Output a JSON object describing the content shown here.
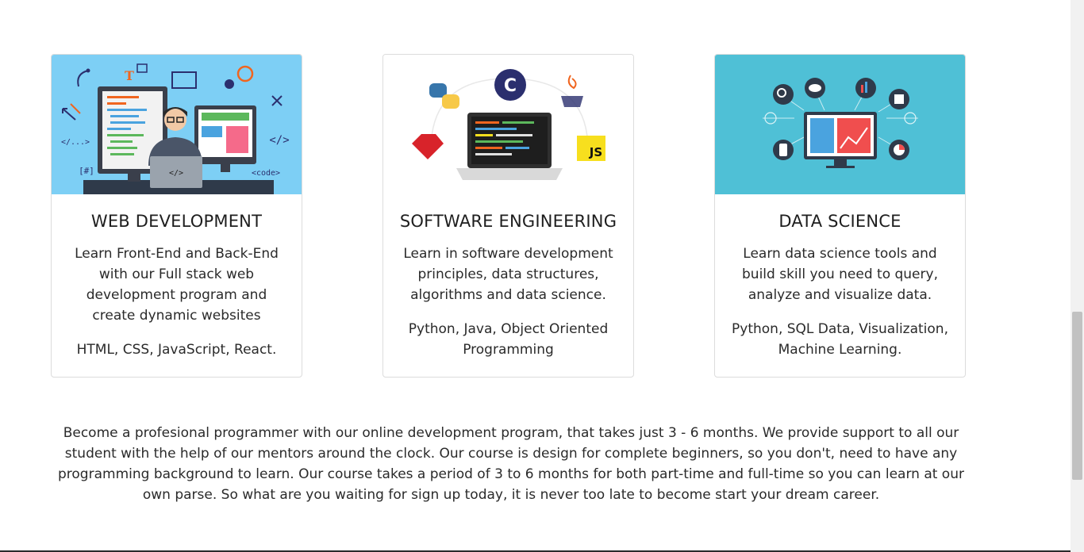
{
  "courses": [
    {
      "title": "WEB DEVELOPMENT",
      "description": "Learn Front-End and Back-End with our Full stack web development program and create dynamic websites",
      "technologies": "HTML, CSS, JavaScript, React.",
      "thumb_bg": "#7dcff5",
      "thumb_labels": {
        "t": "T",
        "html": "</...>",
        "tag": "</>",
        "hash": "[#]",
        "code": "<code>",
        "laptop": "</>"
      }
    },
    {
      "title": "SOFTWARE ENGINEERING",
      "description": "Learn in software development principles, data structures, algorithms and data science.",
      "technologies": "Python, Java, Object Oriented Programming",
      "thumb_bg": "#ffffff",
      "thumb_labels": {
        "c": "C",
        "js": "JS"
      }
    },
    {
      "title": "DATA SCIENCE",
      "description": "Learn data science tools and build skill you need to query, analyze and visualize data.",
      "technologies": "Python, SQL Data, Visualization, Machine Learning.",
      "thumb_bg": "#4fc0d6",
      "thumb_labels": {}
    }
  ],
  "about_text": "Become a profesional programmer with our online development program, that takes just 3 - 6 months. We provide support to all our student with the help of our mentors around the clock. Our course is design for complete beginners, so you don't, need to have any programming background to learn. Our course takes a period of 3 to 6 months for both part-time and full-time so you can learn at our own parse. So what are you waiting for sign up today, it is never too late to become start your dream career.",
  "colors": {
    "accent_orange": "#f0651f",
    "navy": "#2b2f6e",
    "js_yellow": "#f7df1e",
    "ruby_red": "#d8232a"
  },
  "icons": [
    "web-development-illustration",
    "software-engineering-illustration",
    "data-science-illustration"
  ]
}
